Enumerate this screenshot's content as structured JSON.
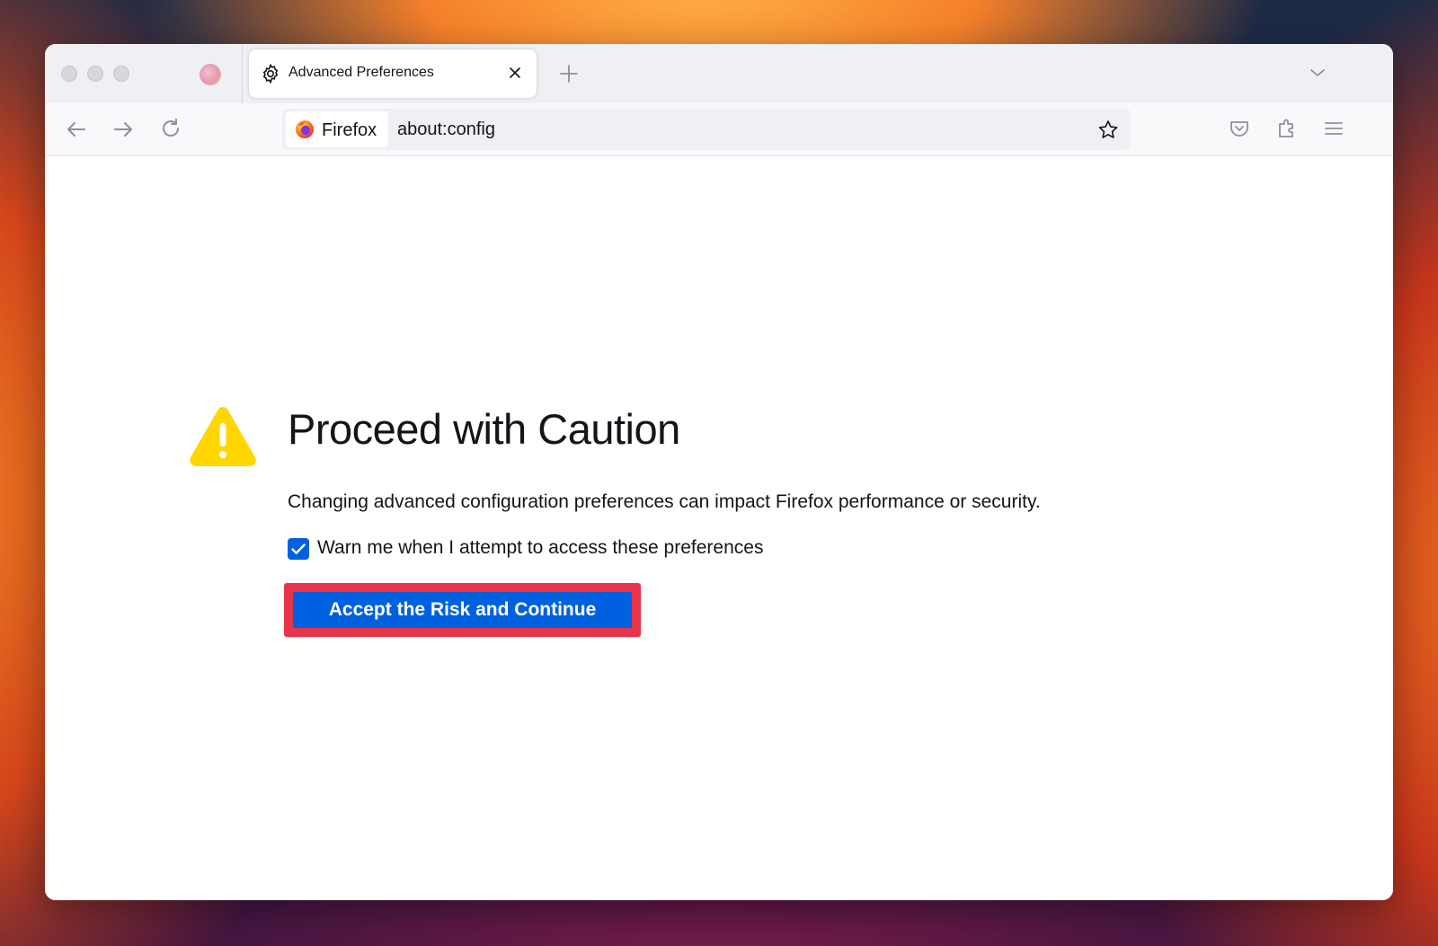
{
  "colors": {
    "accent": "#0061e0",
    "highlight_border": "#e8344a",
    "warning_yellow": "#ffd600"
  },
  "tabbar": {
    "active_tab": {
      "title": "Advanced Preferences",
      "icon": "gear-icon"
    },
    "pinned_tab_icon": "firefox-view-icon"
  },
  "navbar": {
    "identity_label": "Firefox",
    "url": "about:config"
  },
  "page": {
    "title": "Proceed with Caution",
    "description": "Changing advanced configuration preferences can impact Firefox performance or security.",
    "warn_checkbox": {
      "label": "Warn me when I attempt to access these preferences",
      "checked": true
    },
    "accept_button_label": "Accept the Risk and Continue"
  }
}
